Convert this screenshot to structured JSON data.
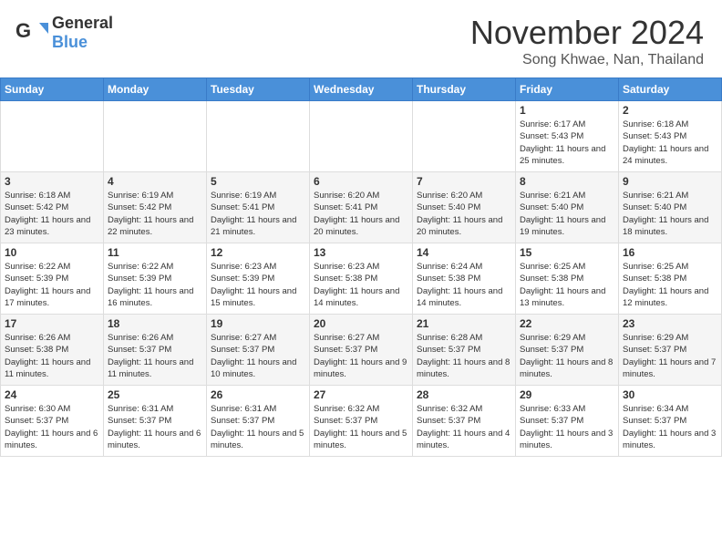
{
  "header": {
    "logo_general": "General",
    "logo_blue": "Blue",
    "month_title": "November 2024",
    "location": "Song Khwae, Nan, Thailand"
  },
  "calendar": {
    "headers": [
      "Sunday",
      "Monday",
      "Tuesday",
      "Wednesday",
      "Thursday",
      "Friday",
      "Saturday"
    ],
    "weeks": [
      [
        {
          "day": "",
          "info": ""
        },
        {
          "day": "",
          "info": ""
        },
        {
          "day": "",
          "info": ""
        },
        {
          "day": "",
          "info": ""
        },
        {
          "day": "",
          "info": ""
        },
        {
          "day": "1",
          "info": "Sunrise: 6:17 AM\nSunset: 5:43 PM\nDaylight: 11 hours and 25 minutes."
        },
        {
          "day": "2",
          "info": "Sunrise: 6:18 AM\nSunset: 5:43 PM\nDaylight: 11 hours and 24 minutes."
        }
      ],
      [
        {
          "day": "3",
          "info": "Sunrise: 6:18 AM\nSunset: 5:42 PM\nDaylight: 11 hours and 23 minutes."
        },
        {
          "day": "4",
          "info": "Sunrise: 6:19 AM\nSunset: 5:42 PM\nDaylight: 11 hours and 22 minutes."
        },
        {
          "day": "5",
          "info": "Sunrise: 6:19 AM\nSunset: 5:41 PM\nDaylight: 11 hours and 21 minutes."
        },
        {
          "day": "6",
          "info": "Sunrise: 6:20 AM\nSunset: 5:41 PM\nDaylight: 11 hours and 20 minutes."
        },
        {
          "day": "7",
          "info": "Sunrise: 6:20 AM\nSunset: 5:40 PM\nDaylight: 11 hours and 20 minutes."
        },
        {
          "day": "8",
          "info": "Sunrise: 6:21 AM\nSunset: 5:40 PM\nDaylight: 11 hours and 19 minutes."
        },
        {
          "day": "9",
          "info": "Sunrise: 6:21 AM\nSunset: 5:40 PM\nDaylight: 11 hours and 18 minutes."
        }
      ],
      [
        {
          "day": "10",
          "info": "Sunrise: 6:22 AM\nSunset: 5:39 PM\nDaylight: 11 hours and 17 minutes."
        },
        {
          "day": "11",
          "info": "Sunrise: 6:22 AM\nSunset: 5:39 PM\nDaylight: 11 hours and 16 minutes."
        },
        {
          "day": "12",
          "info": "Sunrise: 6:23 AM\nSunset: 5:39 PM\nDaylight: 11 hours and 15 minutes."
        },
        {
          "day": "13",
          "info": "Sunrise: 6:23 AM\nSunset: 5:38 PM\nDaylight: 11 hours and 14 minutes."
        },
        {
          "day": "14",
          "info": "Sunrise: 6:24 AM\nSunset: 5:38 PM\nDaylight: 11 hours and 14 minutes."
        },
        {
          "day": "15",
          "info": "Sunrise: 6:25 AM\nSunset: 5:38 PM\nDaylight: 11 hours and 13 minutes."
        },
        {
          "day": "16",
          "info": "Sunrise: 6:25 AM\nSunset: 5:38 PM\nDaylight: 11 hours and 12 minutes."
        }
      ],
      [
        {
          "day": "17",
          "info": "Sunrise: 6:26 AM\nSunset: 5:38 PM\nDaylight: 11 hours and 11 minutes."
        },
        {
          "day": "18",
          "info": "Sunrise: 6:26 AM\nSunset: 5:37 PM\nDaylight: 11 hours and 11 minutes."
        },
        {
          "day": "19",
          "info": "Sunrise: 6:27 AM\nSunset: 5:37 PM\nDaylight: 11 hours and 10 minutes."
        },
        {
          "day": "20",
          "info": "Sunrise: 6:27 AM\nSunset: 5:37 PM\nDaylight: 11 hours and 9 minutes."
        },
        {
          "day": "21",
          "info": "Sunrise: 6:28 AM\nSunset: 5:37 PM\nDaylight: 11 hours and 8 minutes."
        },
        {
          "day": "22",
          "info": "Sunrise: 6:29 AM\nSunset: 5:37 PM\nDaylight: 11 hours and 8 minutes."
        },
        {
          "day": "23",
          "info": "Sunrise: 6:29 AM\nSunset: 5:37 PM\nDaylight: 11 hours and 7 minutes."
        }
      ],
      [
        {
          "day": "24",
          "info": "Sunrise: 6:30 AM\nSunset: 5:37 PM\nDaylight: 11 hours and 6 minutes."
        },
        {
          "day": "25",
          "info": "Sunrise: 6:31 AM\nSunset: 5:37 PM\nDaylight: 11 hours and 6 minutes."
        },
        {
          "day": "26",
          "info": "Sunrise: 6:31 AM\nSunset: 5:37 PM\nDaylight: 11 hours and 5 minutes."
        },
        {
          "day": "27",
          "info": "Sunrise: 6:32 AM\nSunset: 5:37 PM\nDaylight: 11 hours and 5 minutes."
        },
        {
          "day": "28",
          "info": "Sunrise: 6:32 AM\nSunset: 5:37 PM\nDaylight: 11 hours and 4 minutes."
        },
        {
          "day": "29",
          "info": "Sunrise: 6:33 AM\nSunset: 5:37 PM\nDaylight: 11 hours and 3 minutes."
        },
        {
          "day": "30",
          "info": "Sunrise: 6:34 AM\nSunset: 5:37 PM\nDaylight: 11 hours and 3 minutes."
        }
      ]
    ]
  }
}
